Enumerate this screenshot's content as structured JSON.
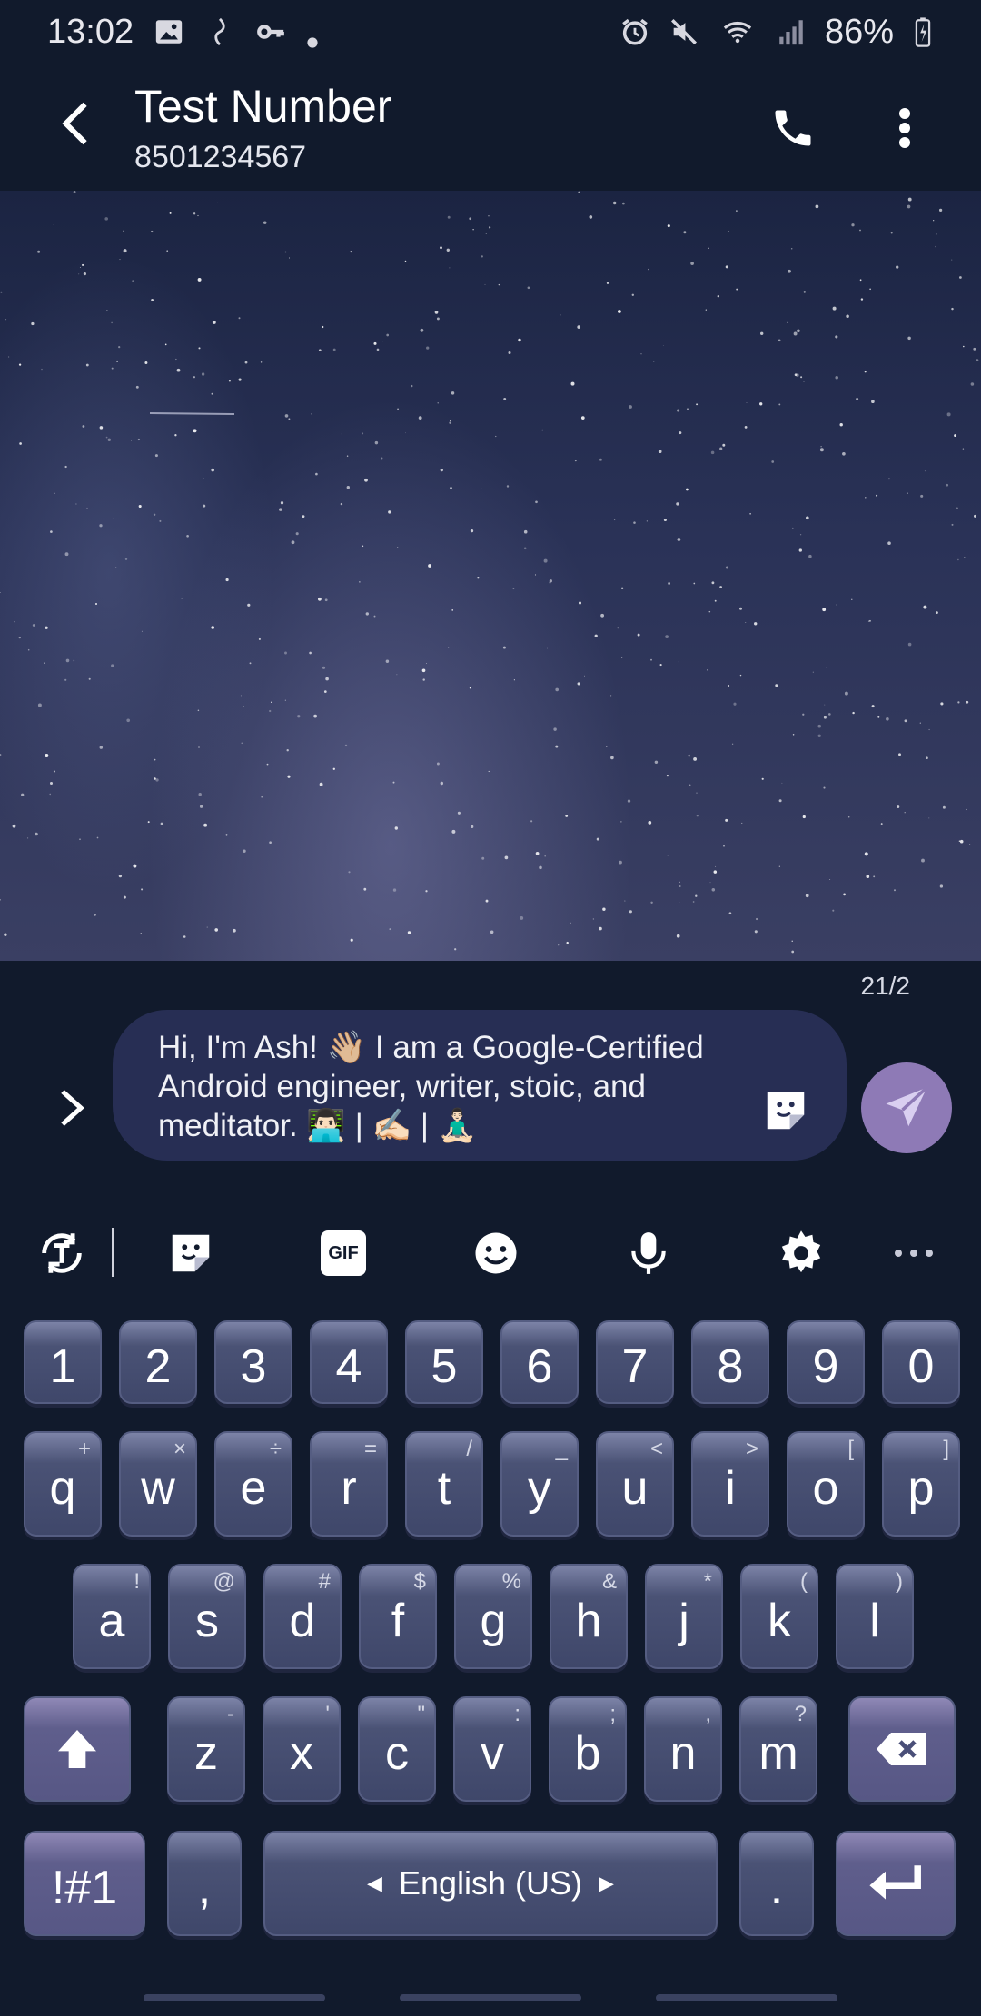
{
  "status_bar": {
    "time": "13:02",
    "battery": "86%",
    "left_icons": [
      "image-icon",
      "audio-icon",
      "key-icon",
      "dot-icon"
    ],
    "right_icons": [
      "alarm-icon",
      "mute-icon",
      "wifi-icon",
      "signal-icon",
      "battery-icon"
    ]
  },
  "header": {
    "contact_name": "Test Number",
    "contact_number": "8501234567",
    "icons": [
      "back-arrow-icon",
      "phone-icon",
      "more-vert-icon"
    ]
  },
  "compose": {
    "counter": "21/2",
    "message_text": "Hi, I'm Ash! 👋🏼 I am a Google-Certified Android engineer, writer, stoic, and meditator. 👨🏻‍💻 | ✍🏻 | 🧘🏻‍♂️",
    "icons": [
      "chevron-right-icon",
      "sticker-icon",
      "send-icon"
    ]
  },
  "keyboard_toolbar": {
    "icons": [
      "text-mode-icon",
      "sticker-icon",
      "gif-icon",
      "emoji-icon",
      "microphone-icon",
      "settings-icon",
      "more-horiz-icon"
    ],
    "gif_label": "GIF"
  },
  "keyboard": {
    "number_row": [
      "1",
      "2",
      "3",
      "4",
      "5",
      "6",
      "7",
      "8",
      "9",
      "0"
    ],
    "row1": [
      {
        "k": "q",
        "h": "+"
      },
      {
        "k": "w",
        "h": "×"
      },
      {
        "k": "e",
        "h": "÷"
      },
      {
        "k": "r",
        "h": "="
      },
      {
        "k": "t",
        "h": "/"
      },
      {
        "k": "y",
        "h": "_"
      },
      {
        "k": "u",
        "h": "<"
      },
      {
        "k": "i",
        "h": ">"
      },
      {
        "k": "o",
        "h": "["
      },
      {
        "k": "p",
        "h": "]"
      }
    ],
    "row2": [
      {
        "k": "a",
        "h": "!"
      },
      {
        "k": "s",
        "h": "@"
      },
      {
        "k": "d",
        "h": "#"
      },
      {
        "k": "f",
        "h": "$"
      },
      {
        "k": "g",
        "h": "%"
      },
      {
        "k": "h",
        "h": "&"
      },
      {
        "k": "j",
        "h": "*"
      },
      {
        "k": "k",
        "h": "("
      },
      {
        "k": "l",
        "h": ")"
      }
    ],
    "row3": [
      {
        "k": "z",
        "h": "-"
      },
      {
        "k": "x",
        "h": "'"
      },
      {
        "k": "c",
        "h": "\""
      },
      {
        "k": "v",
        "h": ":"
      },
      {
        "k": "b",
        "h": ";"
      },
      {
        "k": "n",
        "h": ","
      },
      {
        "k": "m",
        "h": "?"
      }
    ],
    "symbols_label": "!#1",
    "comma_label": ",",
    "period_label": ".",
    "space_label": "English (US)",
    "special_icons": [
      "shift-icon",
      "backspace-icon",
      "enter-icon"
    ]
  },
  "colors": {
    "background": "#111a2c",
    "compose_box": "#272e54",
    "send_button": "#8e7ab6"
  }
}
